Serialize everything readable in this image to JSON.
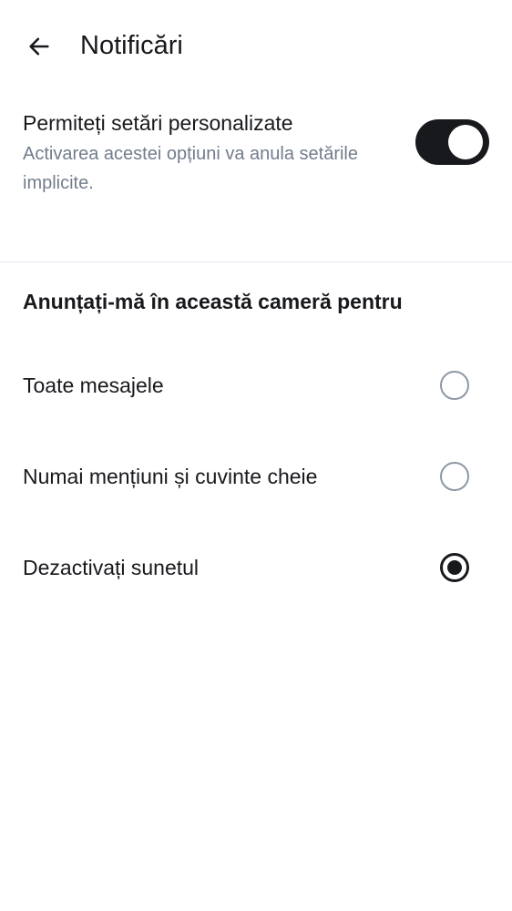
{
  "header": {
    "title": "Notificări"
  },
  "custom_settings": {
    "title": "Permiteți setări personalizate",
    "description": "Activarea acestei opțiuni va anula setările implicite.",
    "enabled": true
  },
  "notify_section": {
    "title": "Anunțați-mă în această cameră pentru",
    "options": [
      {
        "label": "Toate mesajele",
        "selected": false
      },
      {
        "label": "Numai mențiuni și cuvinte cheie",
        "selected": false
      },
      {
        "label": "Dezactivați sunetul",
        "selected": true
      }
    ]
  },
  "colors": {
    "accent": "#17191c",
    "secondary_text": "#737d8c",
    "divider": "#e3e8f0",
    "radio_unselected": "#8d97a5"
  },
  "icons": {
    "back": "arrow-left-icon"
  }
}
